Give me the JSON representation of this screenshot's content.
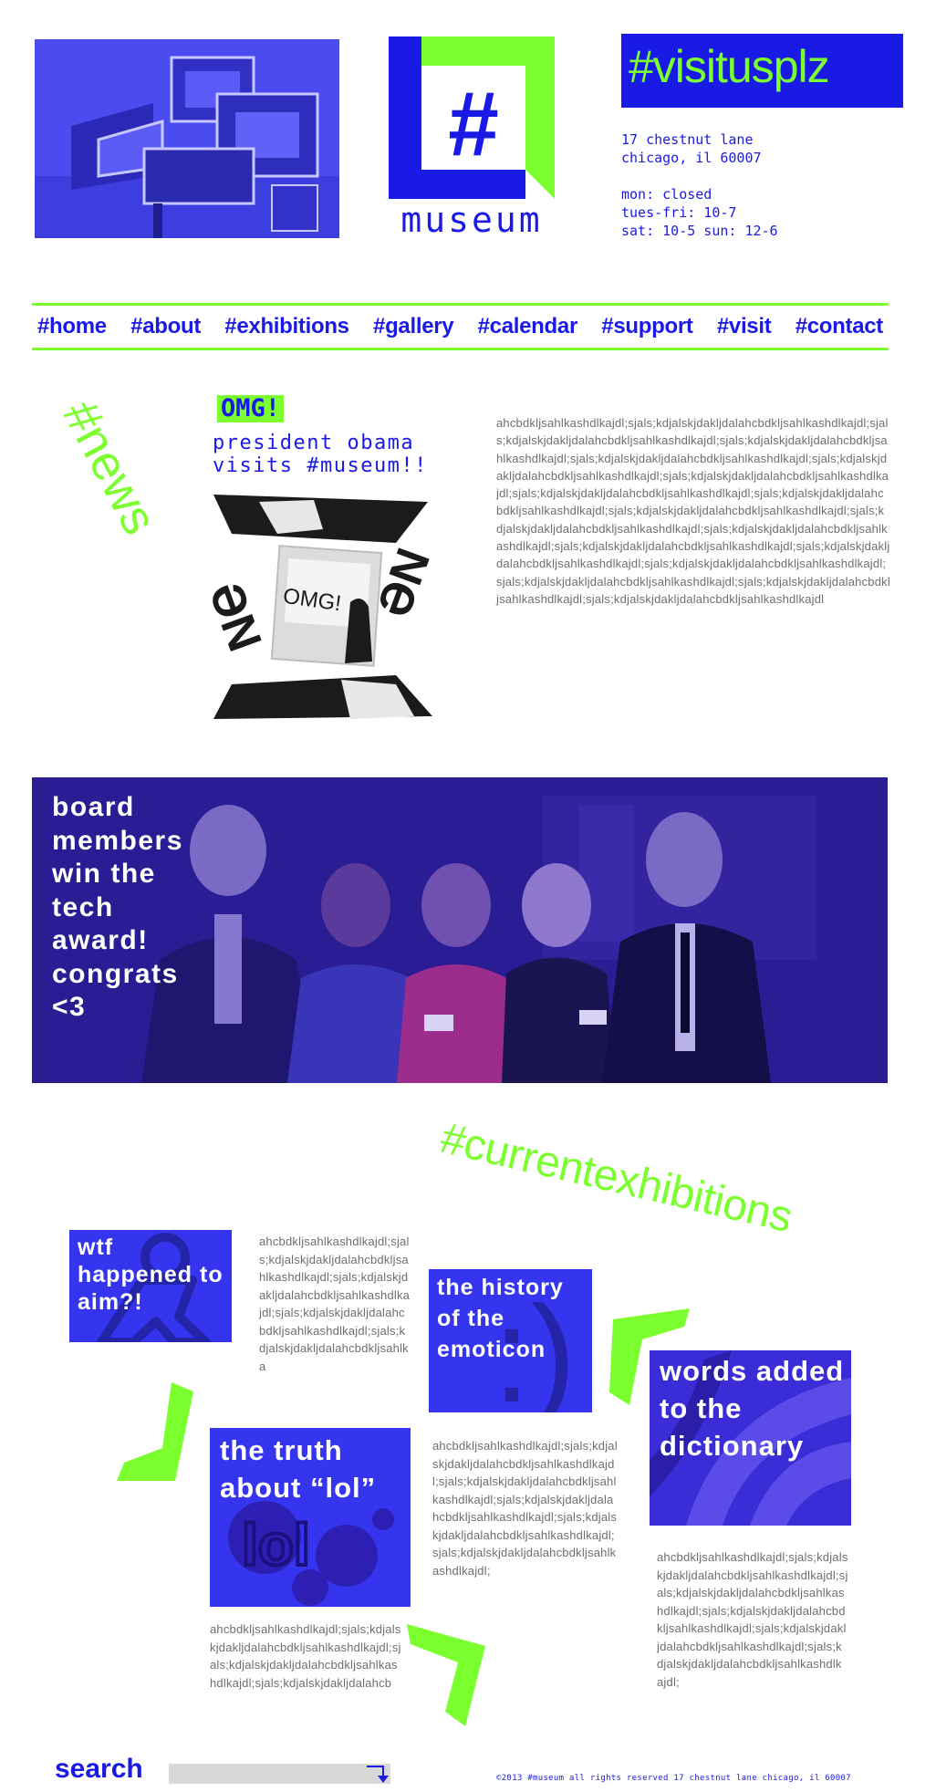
{
  "header": {
    "logo_symbol": "#",
    "logo_title": "museum",
    "hashtag": "#visitusplz",
    "address_line1": "17 chestnut lane",
    "address_line2": "chicago, il 60007",
    "hours_line1": "mon: closed",
    "hours_line2": "tues-fri: 10-7",
    "hours_line3": "sat: 10-5 sun: 12-6"
  },
  "nav": {
    "items": [
      "#home",
      "#about",
      "#exhibitions",
      "#gallery",
      "#calendar",
      "#support",
      "#visit",
      "#contact"
    ]
  },
  "news": {
    "heading": "#news",
    "badge": "OMG!",
    "headline": "president obama visits #museum!!",
    "image_caption": "OMG!",
    "body": "ahcbdkljsahlkashdlkajdl;sjals;kdjalskjdakljdalahcbdkljsahlkashdlkajdl;sjals;kdjalskjdakljdalahcbdkljsahlkashdlkajdl;sjals;kdjalskjdakljdalahcbdkljsahlkashdlkajdl;sjals;kdjalskjdakljdalahcbdkljsahlkashdlkajdl;sjals;kdjalskjdakljdalahcbdkljsahlkashdlkajdl;sjals;kdjalskjdakljdalahcbdkljsahlkashdlkajdl;sjals;kdjalskjdakljdalahcbdkljsahlkashdlkajdl;sjals;kdjalskjdakljdalahcbdkljsahlkashdlkajdl;sjals;kdjalskjdakljdalahcbdkljsahlkashdlkajdl;sjals;kdjalskjdakljdalahcbdkljsahlkashdlkajdl;sjals;kdjalskjdakljdalahcbdkljsahlkashdlkajdl;sjals;kdjalskjdakljdalahcbdkljsahlkashdlkajdl;sjals;kdjalskjdakljdalahcbdkljsahlkashdlkajdl;sjals;kdjalskjdakljdalahcbdkljsahlkashdlkajdl;sjals;kdjalskjdakljdalahcbdkljsahlkashdlkajdl;sjals;kdjalskjdakljdalahcbdkljsahlkashdlkajdl;sjals;kdjalskjdakljdalahcbdkljsahlkashdlkajdl"
  },
  "banner": {
    "caption_line1": "board",
    "caption_line2": "members",
    "caption_line3": "win the",
    "caption_line4": "tech",
    "caption_line5": "award!",
    "caption_line6": "congrats",
    "caption_line7": "<3"
  },
  "exhibitions": {
    "heading": "#currentexhibitions",
    "aim": {
      "title": "wtf happened to aim?!",
      "body": "ahcbdkljsahlkashdlkajdl;sjals;kdjalskjdakljdalahcbdkljsahlkashdlkajdl;sjals;kdjalskjdakljdalahcbdkljsahlkashdlkajdl;sjals;kdjalskjdakljdalahcbdkljsahlkashdlkajdl;sjals;kdjalskjdakljdalahcbdkljsahlka"
    },
    "emoticon": {
      "title": "the history of the emoticon",
      "symbol": ":)"
    },
    "lol": {
      "title": "the truth about “lol”",
      "symbol": "lol",
      "body_right": "ahcbdkljsahlkashdlkajdl;sjals;kdjalskjdakljdalahcbdkljsahlkashdlkajdl;sjals;kdjalskjdakljdalahcbdkljsahlkashdlkajdl;sjals;kdjalskjdakljdalahcbdkljsahlkashdlkajdl;sjals;kdjalskjdakljdalahcbdkljsahlkashdlkajdl;sjals;kdjalskjdakljdalahcbdkljsahlkashdlkajdl;",
      "body_below": "ahcbdkljsahlkashdlkajdl;sjals;kdjalskjdakljdalahcbdkljsahlkashdlkajdl;sjals;kdjalskjdakljdalahcbdkljsahlkashdlkajdl;sjals;kdjalskjdakljdalahcb"
    },
    "words": {
      "title": "words added to the dictionary",
      "body": "ahcbdkljsahlkashdlkajdl;sjals;kdjalskjdakljdalahcbdkljsahlkashdlkajdl;sjals;kdjalskjdakljdalahcbdkljsahlkashdlkajdl;sjals;kdjalskjdakljdalahcbdkljsahlkashdlkajdl;sjals;kdjalskjdakljdalahcbdkljsahlkashdlkajdl;sjals;kdjalskjdakljdalahcbdkljsahlkashdlkajdl;"
    }
  },
  "footer": {
    "search_label": "search",
    "search_placeholder": "",
    "copyright": "©2013 #museum all rights reserved  17 chestnut lane chicago, il 60007"
  },
  "colors": {
    "blue": "#1a1ae6",
    "green": "#7cff2e",
    "body_text": "#6e6e6e"
  }
}
